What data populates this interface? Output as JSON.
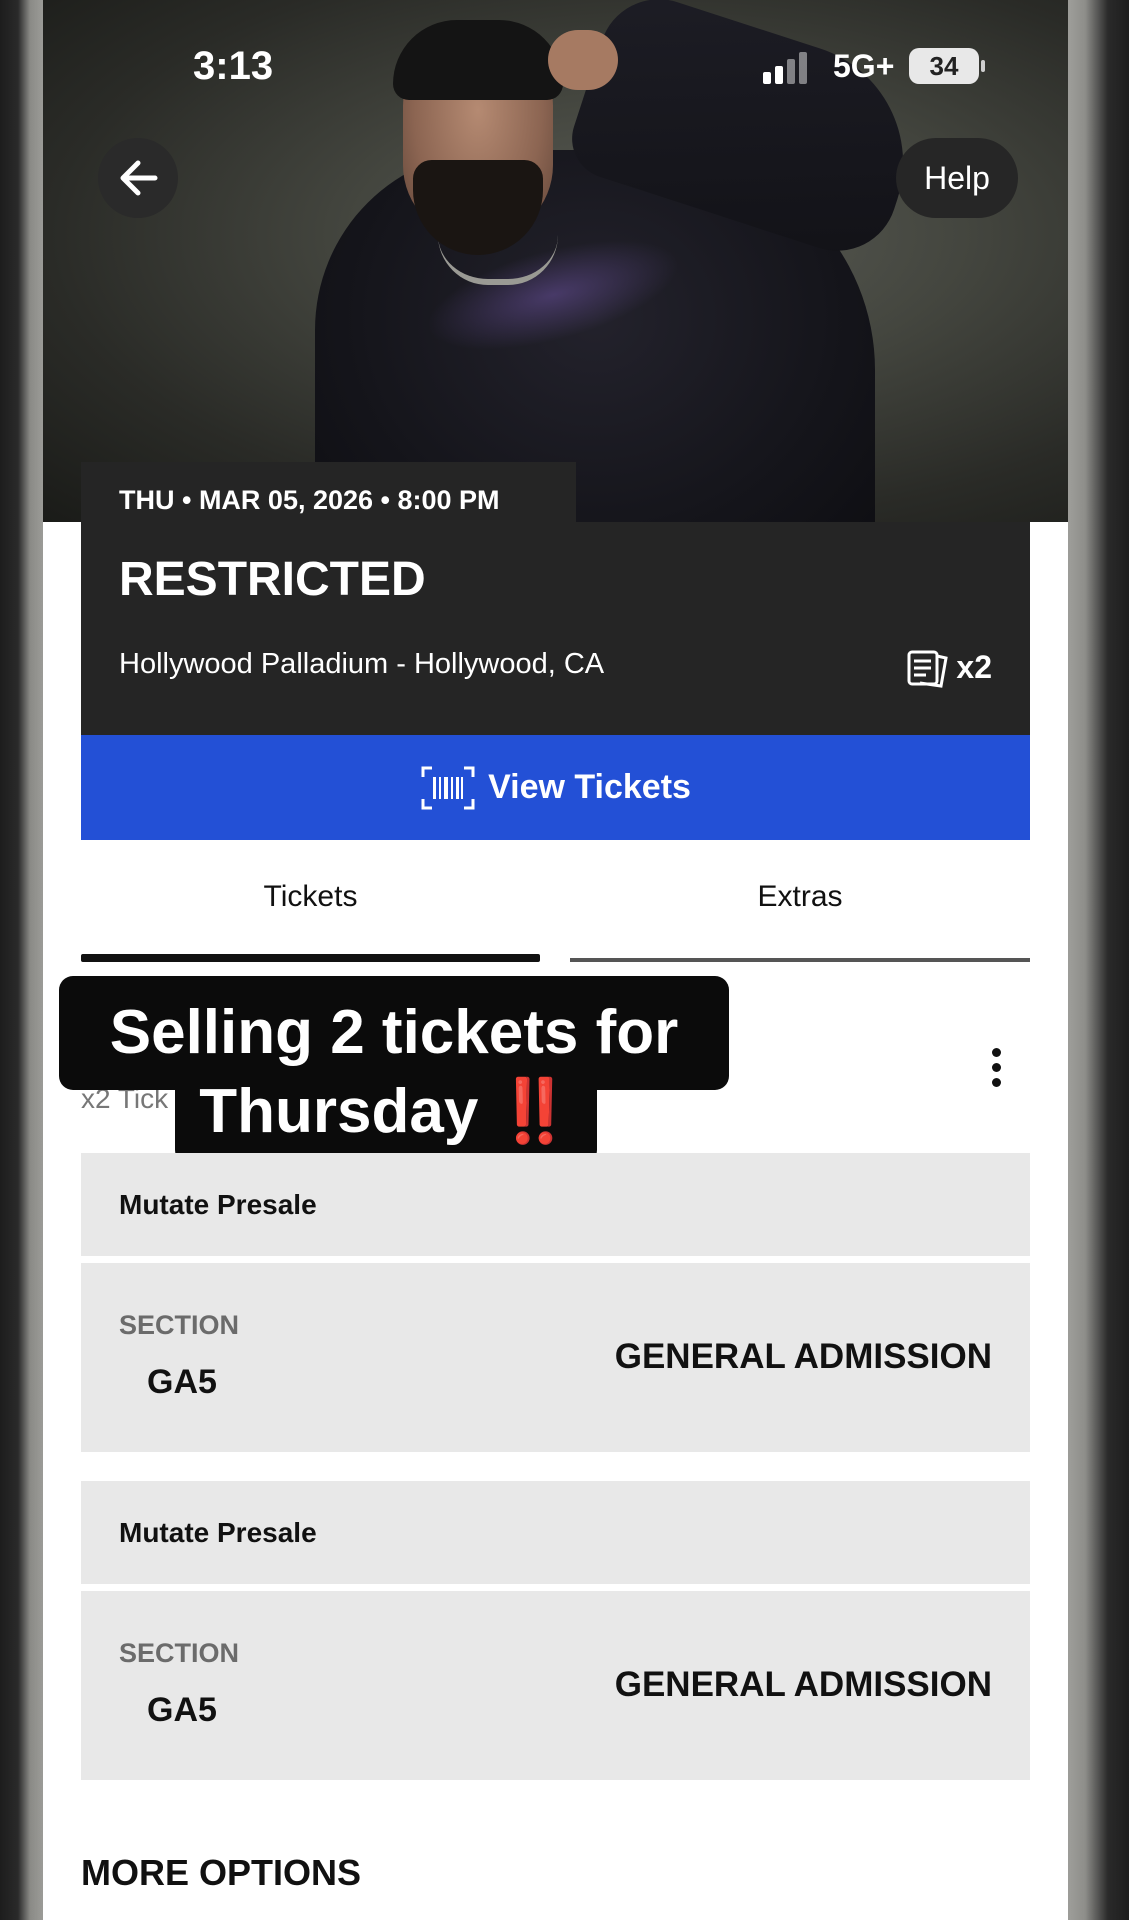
{
  "status_bar": {
    "time": "3:13",
    "network": "5G+",
    "battery": "34"
  },
  "header": {
    "back_icon": "arrow-left-icon",
    "help_label": "Help"
  },
  "event": {
    "datetime": "THU • MAR 05, 2026 • 8:00 PM",
    "title": "RESTRICTED",
    "venue": "Hollywood Palladium - Hollywood, CA",
    "ticket_count": "x2",
    "ticket_icon": "ticket-stack-icon"
  },
  "view_tickets": {
    "label": "View Tickets",
    "icon": "barcode-icon",
    "color": "#2350d6"
  },
  "tabs": [
    {
      "label": "Tickets",
      "active": true
    },
    {
      "label": "Extras",
      "active": false
    }
  ],
  "ticket_list": {
    "subtitle": "x2 Tick"
  },
  "caption": {
    "line1": "Selling 2 tickets for",
    "line2": "Thursday",
    "emoji": "‼️"
  },
  "tickets": [
    {
      "presale": "Mutate Presale",
      "section_label": "SECTION",
      "section": "GA5",
      "admission": "GENERAL ADMISSION"
    },
    {
      "presale": "Mutate Presale",
      "section_label": "SECTION",
      "section": "GA5",
      "admission": "GENERAL ADMISSION"
    }
  ],
  "more_options": "MORE OPTIONS"
}
